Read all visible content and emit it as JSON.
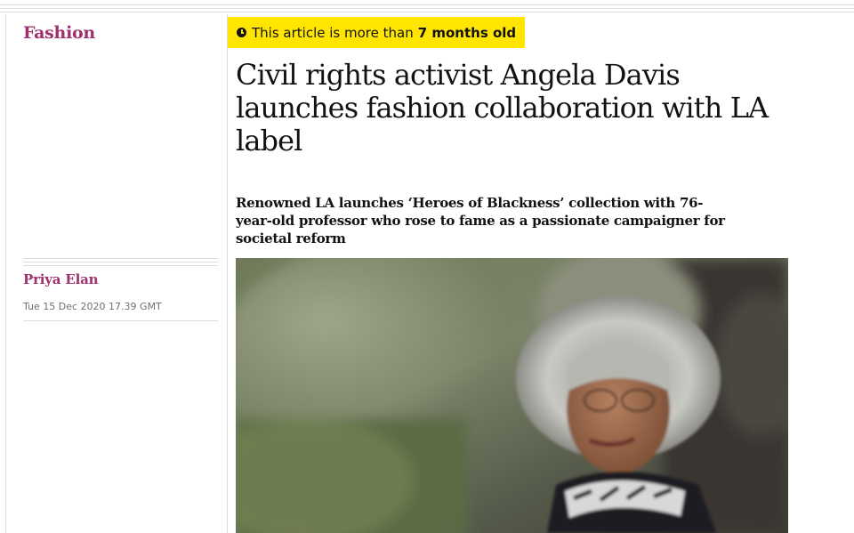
{
  "section": {
    "label": "Fashion",
    "color": "#a1306e"
  },
  "age_warning": {
    "prefix": "This article is more than",
    "age": "7 months old",
    "icon": "clock-icon",
    "color": "#ffe500"
  },
  "article": {
    "headline": "Civil rights activist Angela Davis launches fashion collaboration with LA label",
    "standfirst": "Renowned LA launches ‘Heroes of Blackness’ collection with 76-year-old professor who rose to fame as a passionate campaigner for societal reform"
  },
  "meta": {
    "author": "Priya Elan",
    "date": "Tue 15 Dec 2020 17.39 GMT"
  },
  "image": {
    "subject": "portrait-photo"
  }
}
